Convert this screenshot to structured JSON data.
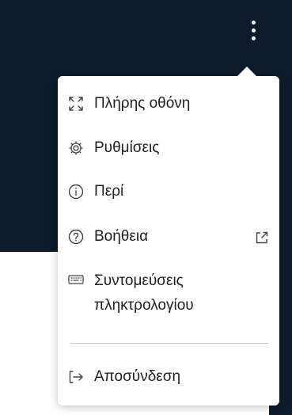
{
  "header": {
    "more_menu_icon": "more-vertical-icon",
    "background_color": "#0d1b2a"
  },
  "menu": {
    "items": [
      {
        "label": "Πλήρης οθόνη",
        "icon": "fullscreen-icon"
      },
      {
        "label": "Ρυθμίσεις",
        "icon": "gear-icon"
      },
      {
        "label": "Περί",
        "icon": "info-icon"
      },
      {
        "label": "Βοήθεια",
        "icon": "help-icon",
        "trailing_icon": "external-link-icon"
      },
      {
        "label": "Συντομεύσεις πληκτρολογίου",
        "icon": "keyboard-icon"
      },
      {
        "label": "Αποσύνδεση",
        "icon": "logout-icon"
      }
    ]
  }
}
